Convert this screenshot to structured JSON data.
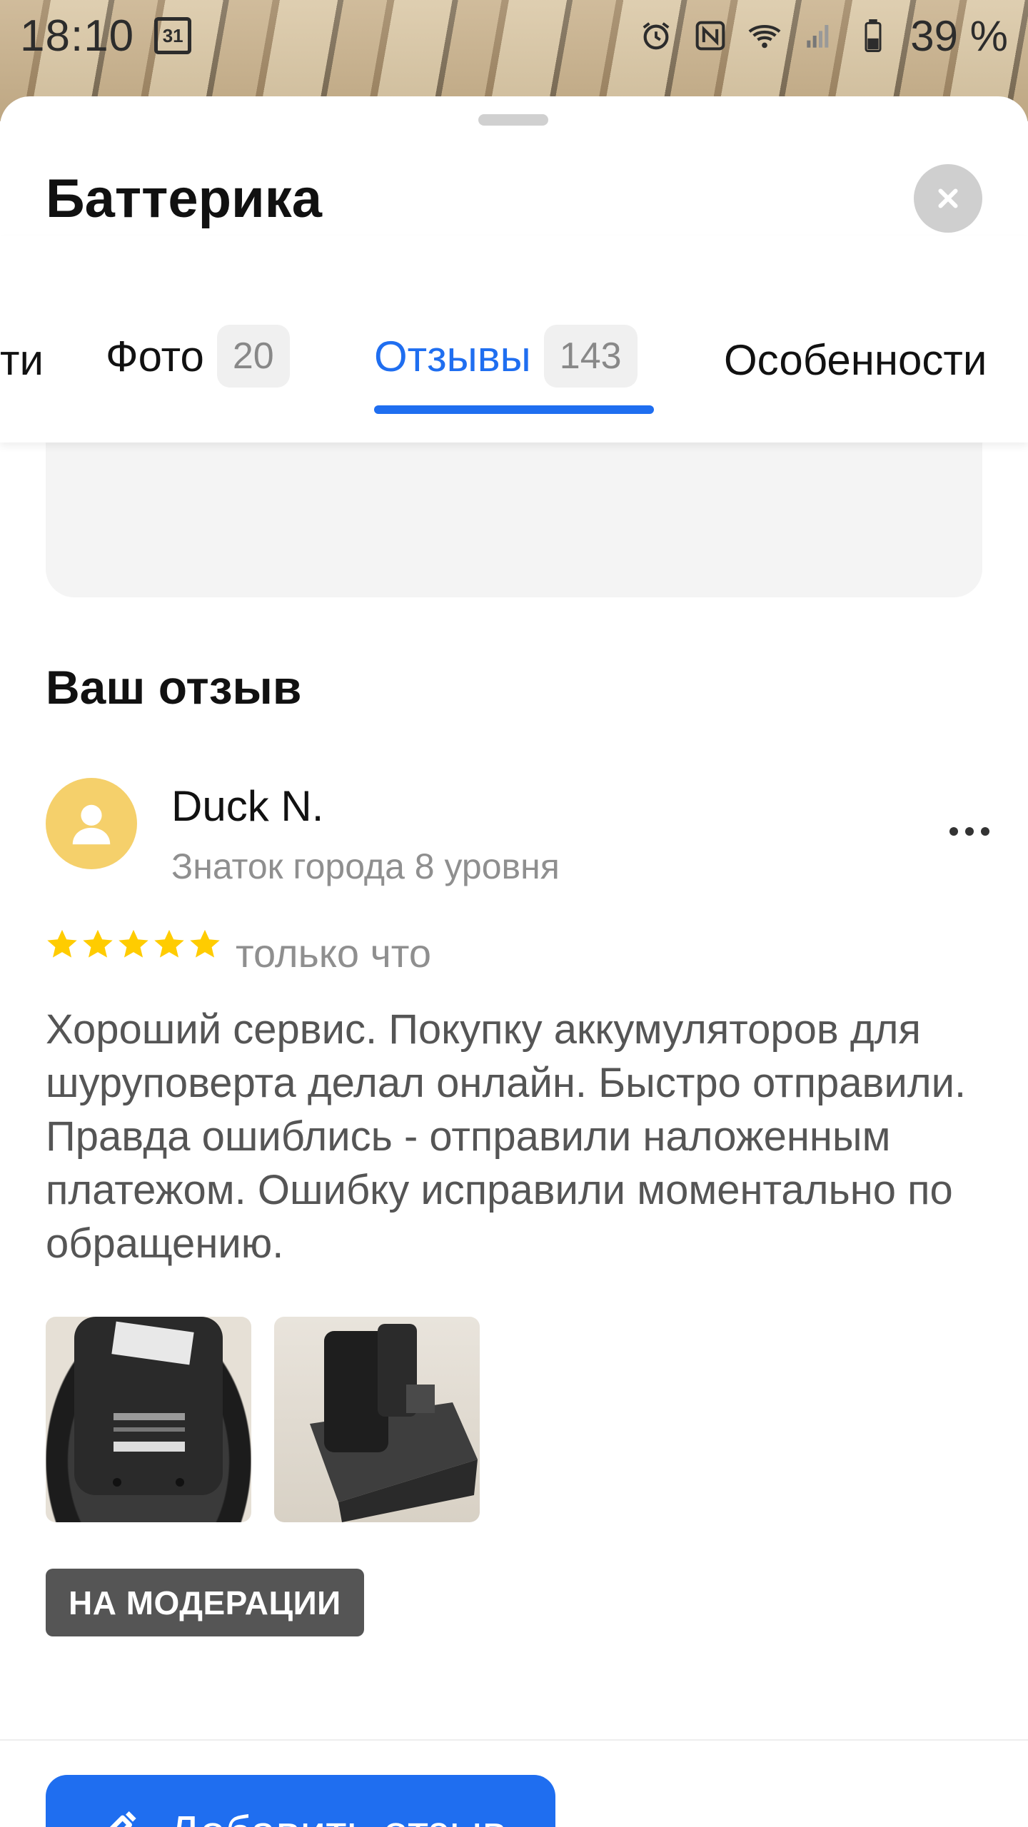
{
  "status_bar": {
    "time": "18:10",
    "calendar_day": "31",
    "battery_percent": "39 %"
  },
  "sheet": {
    "title": "Баттерика"
  },
  "tabs": [
    {
      "label": "ти",
      "count": null,
      "active": false
    },
    {
      "label": "Фото",
      "count": "20",
      "active": false
    },
    {
      "label": "Отзывы",
      "count": "143",
      "active": true
    },
    {
      "label": "Особенности",
      "count": null,
      "active": false
    }
  ],
  "your_review": {
    "section_title": "Ваш отзыв",
    "author_name": "Duck N.",
    "author_level": "Знаток города 8 уровня",
    "rating": 5,
    "time": "только что",
    "text": "Хороший сервис. Покупку аккумуляторов для шуруповерта делал онлайн. Быстро отправили. Правда ошиблись - отправили наложенным платежом. Ошибку исправили моментально по обращению.",
    "photos": [
      "battery-photo-back",
      "battery-photo-side"
    ],
    "status_badge": "НА МОДЕРАЦИИ"
  },
  "actions": {
    "add_review_label": "Добавить отзыв"
  },
  "colors": {
    "accent": "#1f6ef0",
    "star": "#ffcc00",
    "avatar": "#f5d06b",
    "badge_bg": "#555555"
  }
}
